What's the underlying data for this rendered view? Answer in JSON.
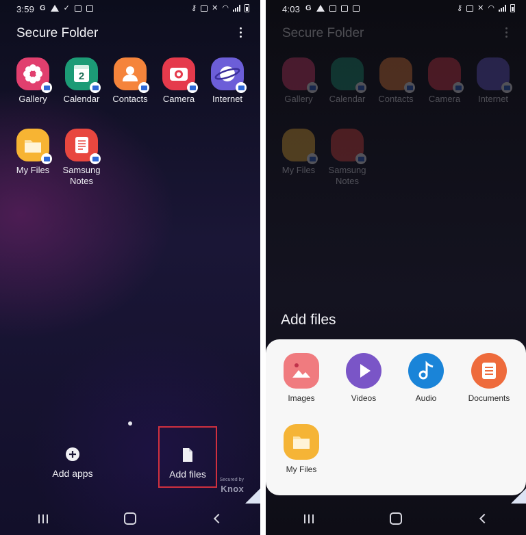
{
  "left_screen": {
    "status": {
      "time": "3:59",
      "left_icons": [
        "G",
        "warning-icon",
        "check-icon",
        "image-icon",
        "x-box-icon"
      ]
    },
    "title": "Secure Folder",
    "apps": [
      {
        "label": "Gallery",
        "color": "#e13f6e",
        "icon": "flower-icon"
      },
      {
        "label": "Calendar",
        "color": "#1c9b76",
        "icon": "calendar-icon",
        "glyph": "2"
      },
      {
        "label": "Contacts",
        "color": "#f5843b",
        "icon": "person-icon"
      },
      {
        "label": "Camera",
        "color": "#e53a4c",
        "icon": "camera-icon"
      },
      {
        "label": "Internet",
        "color": "#6c5ed8",
        "icon": "planet-icon"
      },
      {
        "label": "My Files",
        "color": "#f7b433",
        "icon": "folder-icon"
      },
      {
        "label_line1": "Samsung",
        "label_line2": "Notes",
        "color": "#e8473f",
        "icon": "notes-icon"
      }
    ],
    "actions": {
      "add_apps": "Add apps",
      "add_files": "Add files"
    },
    "knox": {
      "secured_by": "Secured by",
      "brand": "Knox"
    },
    "highlight_color": "#d0303f"
  },
  "right_screen": {
    "status": {
      "time": "4:03"
    },
    "title": "Secure Folder",
    "sheet_title": "Add files",
    "options": [
      {
        "label": "Images",
        "color": "#f07b7f",
        "icon": "image-icon"
      },
      {
        "label": "Videos",
        "color": "#7a55c7",
        "icon": "play-icon"
      },
      {
        "label": "Audio",
        "color": "#1a84d8",
        "icon": "music-note-icon"
      },
      {
        "label": "Documents",
        "color": "#ee6b3c",
        "icon": "document-icon"
      },
      {
        "label": "My Files",
        "color": "#f5b436",
        "icon": "folder-icon"
      }
    ]
  }
}
